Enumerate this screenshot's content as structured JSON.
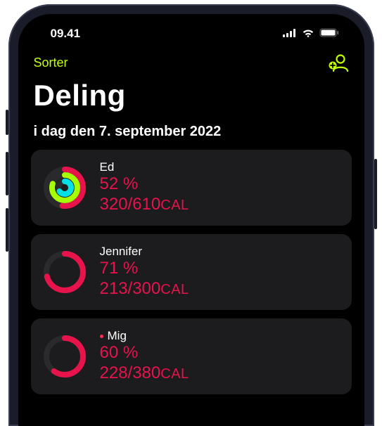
{
  "status": {
    "time": "09.41"
  },
  "nav": {
    "sort_label": "Sorter"
  },
  "header": {
    "title": "Deling",
    "subtitle": "i dag den 7. september 2022"
  },
  "colors": {
    "accent": "#c2ff00",
    "move": "#e7134b",
    "exercise": "#a6ff00",
    "stand": "#00e0e6",
    "ring_bg": "#2a2a2c"
  },
  "people": [
    {
      "name": "Ed",
      "is_me": false,
      "percent_label": "52 %",
      "cal_value": "320/610",
      "cal_unit": "CAL",
      "move_pct": 52,
      "exercise_pct": 80,
      "stand_pct": 65,
      "show_inner_rings": true
    },
    {
      "name": "Jennifer",
      "is_me": false,
      "percent_label": "71 %",
      "cal_value": "213/300",
      "cal_unit": "CAL",
      "move_pct": 71,
      "exercise_pct": 0,
      "stand_pct": 0,
      "show_inner_rings": false
    },
    {
      "name": "Mig",
      "is_me": true,
      "percent_label": "60 %",
      "cal_value": "228/380",
      "cal_unit": "CAL",
      "move_pct": 60,
      "exercise_pct": 0,
      "stand_pct": 0,
      "show_inner_rings": false
    }
  ]
}
